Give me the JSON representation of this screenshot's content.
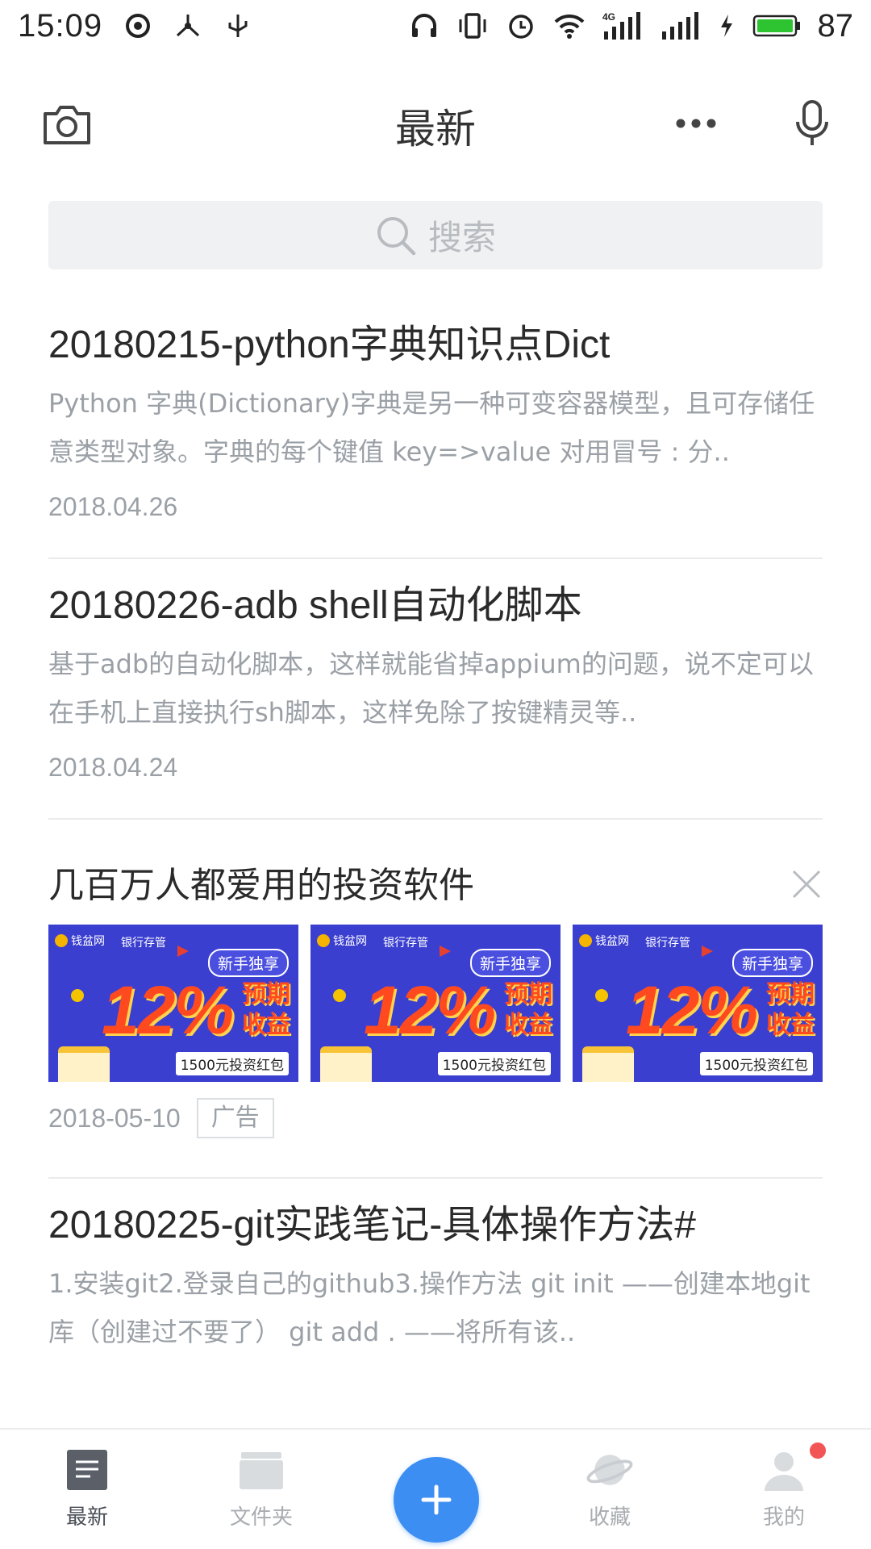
{
  "status_bar": {
    "time": "15:09",
    "battery_percent": "87",
    "network_label": "4G",
    "icons": [
      "sync-icon",
      "usb-tether-icon",
      "usb-icon",
      "headphones-icon",
      "vibrate-icon",
      "alarm-icon",
      "wifi-icon",
      "signal-4g-icon",
      "signal-icon",
      "charging-icon",
      "battery-icon"
    ]
  },
  "header": {
    "title": "最新",
    "left_icon": "camera-icon",
    "right_icons": [
      "more-icon",
      "microphone-icon"
    ]
  },
  "search": {
    "placeholder": "搜索"
  },
  "notes": [
    {
      "title": "20180215-python字典知识点Dict",
      "summary": "Python 字典(Dictionary)字典是另一种可变容器模型，且可存储任意类型对象。字典的每个键值 key=>value 对用冒号 : 分..",
      "date": "2018.04.26"
    },
    {
      "title": "20180226-adb shell自动化脚本",
      "summary": "基于adb的自动化脚本，这样就能省掉appium的问题，说不定可以在手机上直接执行sh脚本，这样免除了按键精灵等..",
      "date": "2018.04.24"
    }
  ],
  "ad": {
    "title": "几百万人都爱用的投资软件",
    "date": "2018-05-10",
    "tag": "广告",
    "creative": {
      "logo": "钱盆网",
      "bank": "银行存管",
      "badge": "新手独享",
      "big": "12%",
      "side_1": "预期",
      "side_2": "收益",
      "packet": "1500元投资红包"
    },
    "accent_color": "#3b3fd0"
  },
  "notes_after": [
    {
      "title": "20180225-git实践笔记-具体操作方法#",
      "summary": "1.安装git2.登录自己的github3.操作方法 git init            ——创建本地git库（创建过不要了） git add .          ——将所有该.."
    }
  ],
  "bottom_nav": {
    "items": [
      {
        "label": "最新",
        "icon": "note-icon"
      },
      {
        "label": "文件夹",
        "icon": "folder-icon"
      },
      {
        "label": "收藏",
        "icon": "planet-icon"
      },
      {
        "label": "我的",
        "icon": "profile-icon"
      }
    ],
    "fab_icon": "plus-icon",
    "active_color": "#4a4f56",
    "fab_color": "#3d8ef2"
  }
}
